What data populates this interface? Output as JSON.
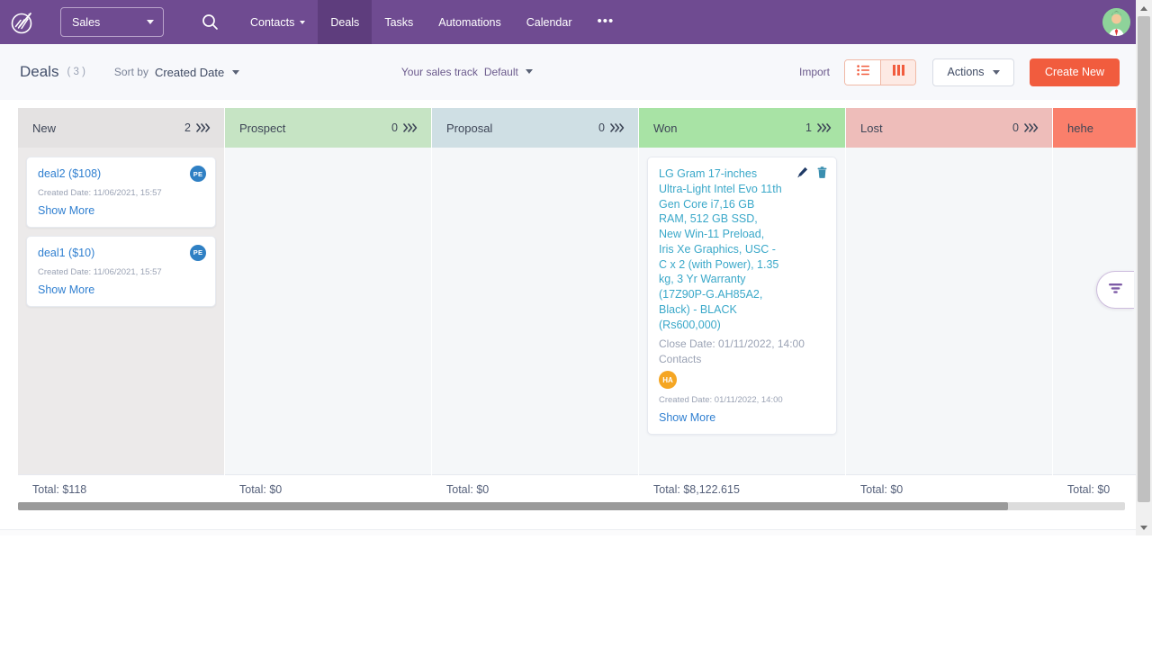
{
  "topnav": {
    "logo_name": "app-logo",
    "track_selector": {
      "label": "Sales",
      "icon": "chevron-down-icon"
    },
    "search_icon": "search-icon",
    "items": [
      {
        "label": "Contacts",
        "has_caret": true,
        "active": false
      },
      {
        "label": "Deals",
        "has_caret": false,
        "active": true
      },
      {
        "label": "Tasks",
        "has_caret": false,
        "active": false
      },
      {
        "label": "Automations",
        "has_caret": false,
        "active": false
      },
      {
        "label": "Calendar",
        "has_caret": false,
        "active": false
      }
    ],
    "overflow_label": "•••",
    "avatar_name": "user-avatar"
  },
  "toolbar": {
    "title": "Deals",
    "count": "( 3 )",
    "sort_by_label": "Sort by",
    "sort_by_value": "Created Date",
    "sales_track_label": "Your sales track",
    "sales_track_value": "Default",
    "import_label": "Import",
    "view_list_icon": "list-view-icon",
    "view_board_icon": "board-view-icon",
    "actions_label": "Actions",
    "create_label": "Create New"
  },
  "board": {
    "columns": [
      {
        "name": "New",
        "count": "2",
        "total": "Total: $118",
        "head_class": "c-new",
        "body_class": "c-new-b",
        "cards": [
          {
            "title": "deal2 ($108)",
            "created": "Created Date: 11/06/2021, 15:57",
            "show_more": "Show More",
            "badge": "PE",
            "badge_color": "#2f80c4",
            "title_color": "blue",
            "tools": false,
            "close_date": null,
            "contacts_label": null,
            "contact_chip": null
          },
          {
            "title": "deal1 ($10)",
            "created": "Created Date: 11/06/2021, 15:57",
            "show_more": "Show More",
            "badge": "PE",
            "badge_color": "#2f80c4",
            "title_color": "blue",
            "tools": false,
            "close_date": null,
            "contacts_label": null,
            "contact_chip": null
          }
        ]
      },
      {
        "name": "Prospect",
        "count": "0",
        "total": "Total: $0",
        "head_class": "c-prospect",
        "body_class": "c-prospect-b",
        "cards": []
      },
      {
        "name": "Proposal",
        "count": "0",
        "total": "Total: $0",
        "head_class": "c-proposal",
        "body_class": "c-proposal-b",
        "cards": []
      },
      {
        "name": "Won",
        "count": "1",
        "total": "Total: $8,122.615",
        "head_class": "c-won",
        "body_class": "c-won-b",
        "cards": [
          {
            "title": "LG Gram 17-inches Ultra-Light Intel Evo 11th Gen Core i7,16 GB RAM, 512 GB SSD, New Win-11 Preload, Iris Xe Graphics, USC -C x 2 (with Power), 1.35 kg, 3 Yr Warranty (17Z90P-G.AH85A2, Black) - BLACK (Rs600,000)",
            "close_date": "Close Date: 01/11/2022, 14:00",
            "contacts_label": "Contacts",
            "contact_chip": "HA",
            "created": "Created Date: 01/11/2022, 14:00",
            "show_more": "Show More",
            "badge": null,
            "badge_color": "#f5a623",
            "title_color": "teal",
            "tools": true
          }
        ]
      },
      {
        "name": "Lost",
        "count": "0",
        "total": "Total: $0",
        "head_class": "c-lost",
        "body_class": "c-lost-b",
        "cards": []
      },
      {
        "name": "hehe",
        "count": "",
        "total": "Total: $0",
        "head_class": "c-hehe",
        "body_class": "c-hehe-b",
        "cards": []
      }
    ],
    "column_arrow_icon": "triple-chevron-right-icon"
  },
  "filter": {
    "icon": "filter-funnel-icon"
  },
  "colors": {
    "brand_purple": "#6f4b91",
    "accent_orange": "#f15c3e",
    "link_blue": "#2f7fd0",
    "teal": "#3aa8c9"
  }
}
